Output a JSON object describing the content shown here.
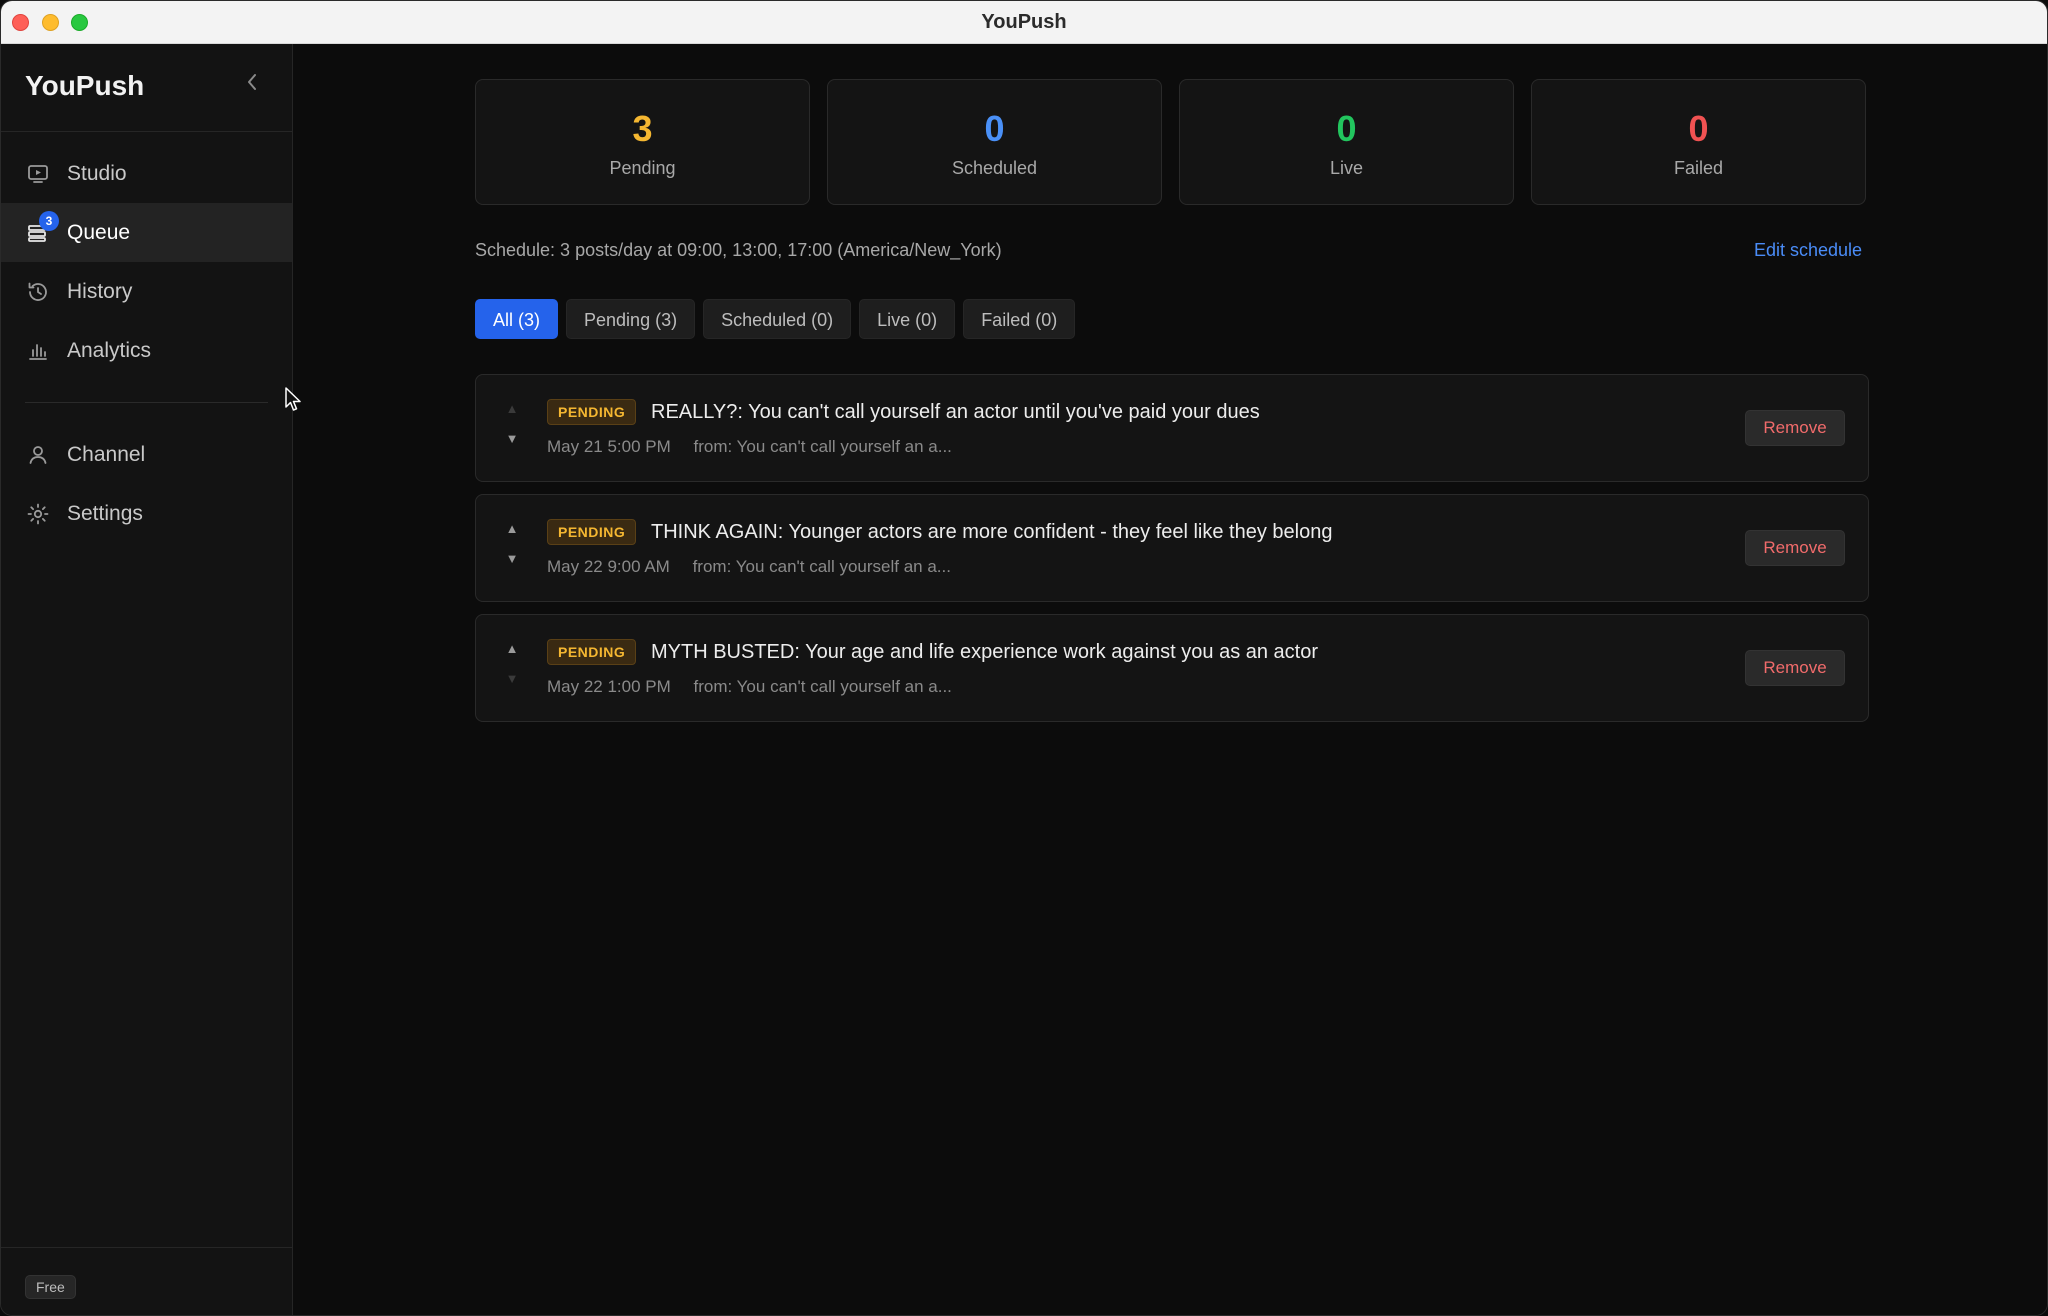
{
  "window": {
    "title": "YouPush"
  },
  "sidebar": {
    "brand": "YouPush",
    "items": [
      {
        "label": "Studio",
        "icon": "monitor-play-icon"
      },
      {
        "label": "Queue",
        "icon": "stack-icon",
        "badge": "3",
        "active": true
      },
      {
        "label": "History",
        "icon": "history-icon"
      },
      {
        "label": "Analytics",
        "icon": "bar-chart-icon"
      },
      {
        "label": "Channel",
        "icon": "user-icon"
      },
      {
        "label": "Settings",
        "icon": "gear-icon"
      }
    ],
    "plan": "Free"
  },
  "stats": [
    {
      "value": "3",
      "label": "Pending",
      "color": "#f5b731"
    },
    {
      "value": "0",
      "label": "Scheduled",
      "color": "#4a90f7"
    },
    {
      "value": "0",
      "label": "Live",
      "color": "#22c55e"
    },
    {
      "value": "0",
      "label": "Failed",
      "color": "#f05252"
    }
  ],
  "schedule": {
    "text": "Schedule: 3 posts/day at 09:00, 13:00, 17:00 (America/New_York)",
    "edit_label": "Edit schedule"
  },
  "filters": [
    {
      "label": "All (3)",
      "active": true
    },
    {
      "label": "Pending (3)"
    },
    {
      "label": "Scheduled (0)"
    },
    {
      "label": "Live (0)"
    },
    {
      "label": "Failed (0)"
    }
  ],
  "queue": [
    {
      "status": "PENDING",
      "title": "REALLY?: You can't call yourself an actor until you've paid your dues",
      "date": "May 21 5:00 PM",
      "source": "from: You can't call yourself an a...",
      "remove_label": "Remove"
    },
    {
      "status": "PENDING",
      "title": "THINK AGAIN: Younger actors are more confident - they feel like they belong",
      "date": "May 22 9:00 AM",
      "source": "from: You can't call yourself an a...",
      "remove_label": "Remove"
    },
    {
      "status": "PENDING",
      "title": "MYTH BUSTED: Your age and life experience work against you as an actor",
      "date": "May 22 1:00 PM",
      "source": "from: You can't call yourself an a...",
      "remove_label": "Remove"
    }
  ],
  "reorder": {
    "up_glyph": "▲",
    "down_glyph": "▼"
  }
}
